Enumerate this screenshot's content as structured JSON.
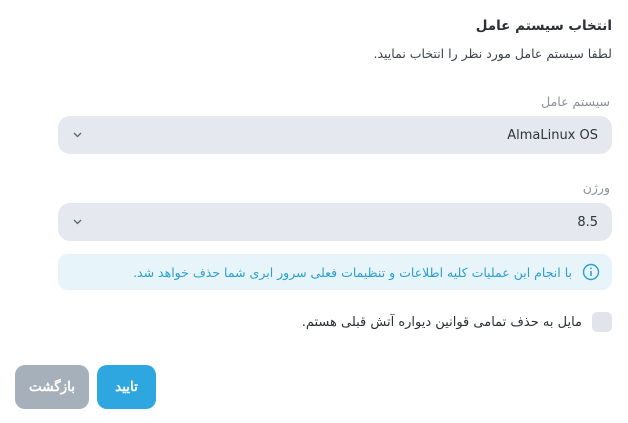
{
  "header": {
    "title": "انتخاب سیستم عامل",
    "subtitle": "لطفا سیستم عامل مورد نظر را انتخاب نمایید."
  },
  "os_field": {
    "label": "سیستم عامل",
    "value": "AlmaLinux OS"
  },
  "version_field": {
    "label": "ورژن",
    "value": "8.5"
  },
  "notice": {
    "text": "با انجام این عملیات کلیه اطلاعات و تنظیمات فعلی سرور ابری شما حذف خواهد شد.",
    "color": "#2a9fd0"
  },
  "firewall_option": {
    "label": "مایل به حذف تمامی قوانین دیواره آتش قبلی هستم.",
    "checked": false
  },
  "actions": {
    "confirm_label": "تایید",
    "back_label": "بازگشت",
    "confirm_color": "#2ea7e0",
    "back_color": "#a6b0bb"
  }
}
